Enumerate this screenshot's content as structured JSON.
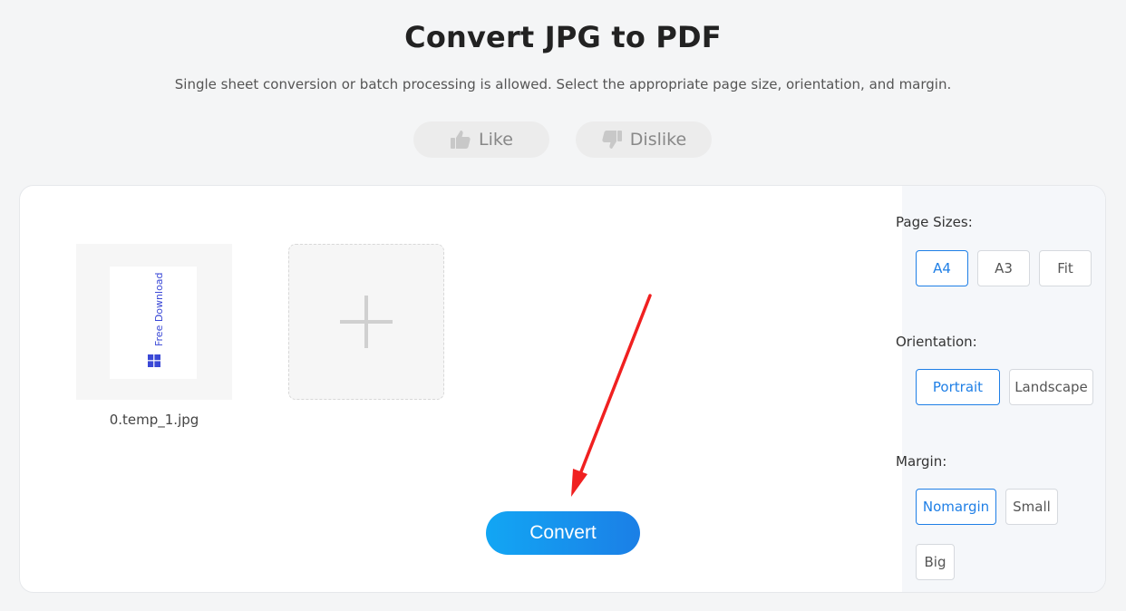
{
  "header": {
    "title": "Convert JPG to PDF",
    "subtitle": "Single sheet conversion or batch processing is allowed. Select the appropriate page size, orientation, and margin."
  },
  "feedback": {
    "like_label": "Like",
    "dislike_label": "Dislike"
  },
  "files": [
    {
      "name": "0.temp_1.jpg",
      "preview_text": "Free Download"
    }
  ],
  "actions": {
    "convert_label": "Convert"
  },
  "options": {
    "page_sizes": {
      "label": "Page Sizes:",
      "items": [
        "A4",
        "A3",
        "Fit"
      ],
      "selected": "A4"
    },
    "orientation": {
      "label": "Orientation:",
      "items": [
        "Portrait",
        "Landscape"
      ],
      "selected": "Portrait"
    },
    "margin": {
      "label": "Margin:",
      "items": [
        "Nomargin",
        "Small",
        "Big"
      ],
      "selected": "Nomargin"
    }
  },
  "colors": {
    "accent": "#1f7fe6",
    "convert_gradient_start": "#12a6f4",
    "convert_gradient_end": "#1b7fe6",
    "annotation_arrow": "#f02020"
  }
}
